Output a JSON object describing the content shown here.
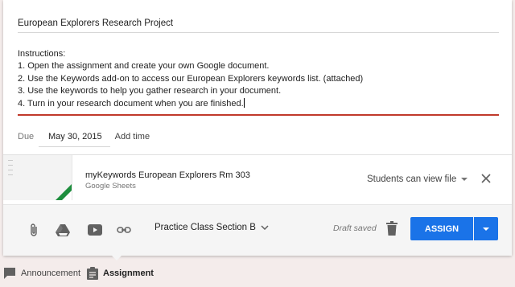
{
  "assignment": {
    "title": "European Explorers Research Project",
    "instructions": [
      "Instructions:",
      "1. Open the assignment and create your own Google document.",
      "2. Use the Keywords add-on to access our European Explorers keywords list. (attached)",
      "3. Use the keywords to help you gather research in your document.",
      "4. Turn in your research document when you are finished."
    ]
  },
  "due": {
    "label": "Due",
    "date": "May 30, 2015",
    "add_time": "Add time"
  },
  "attachment": {
    "title": "myKeywords European Explorers Rm 303",
    "type": "Google Sheets",
    "permission": "Students can view file"
  },
  "toolbar": {
    "class_name": "Practice Class Section B",
    "draft_status": "Draft saved",
    "assign_label": "ASSIGN",
    "accent_color": "#1a73e8",
    "icons": [
      "paperclip-icon",
      "drive-icon",
      "youtube-icon",
      "link-icon",
      "trash-icon"
    ]
  },
  "post_types": {
    "announcement": "Announcement",
    "assignment": "Assignment"
  }
}
